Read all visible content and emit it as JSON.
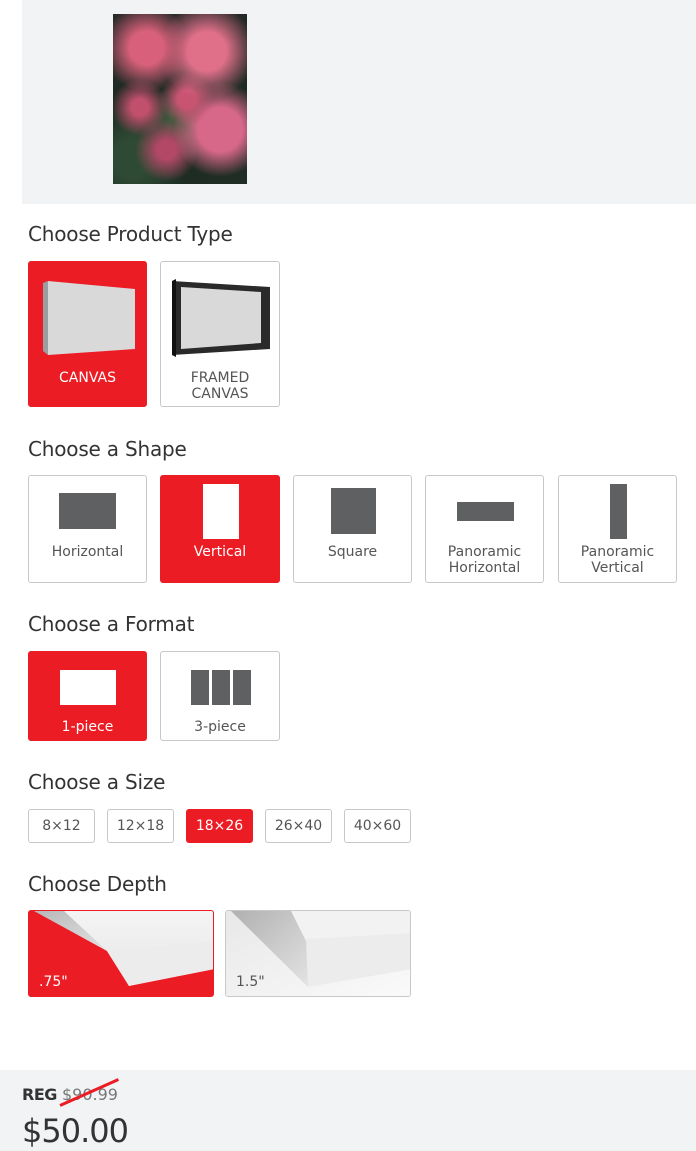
{
  "preview": {
    "image_alt": "pink flower buds artwork preview"
  },
  "product_type": {
    "title": "Choose Product Type",
    "options": [
      {
        "label": "CANVAS",
        "icon": "canvas-icon",
        "selected": true
      },
      {
        "label_lines": [
          "FRAMED",
          "CANVAS"
        ],
        "icon": "framed-canvas-icon",
        "selected": false
      }
    ]
  },
  "shape": {
    "title": "Choose a Shape",
    "options": [
      {
        "label_lines": [
          "Horizontal"
        ],
        "icon": "horizontal-shape-icon",
        "selected": false
      },
      {
        "label_lines": [
          "Vertical"
        ],
        "icon": "vertical-shape-icon",
        "selected": true
      },
      {
        "label_lines": [
          "Square"
        ],
        "icon": "square-shape-icon",
        "selected": false
      },
      {
        "label_lines": [
          "Panoramic",
          "Horizontal"
        ],
        "icon": "panoramic-horizontal-icon",
        "selected": false
      },
      {
        "label_lines": [
          "Panoramic",
          "Vertical"
        ],
        "icon": "panoramic-vertical-icon",
        "selected": false
      }
    ]
  },
  "format": {
    "title": "Choose a Format",
    "options": [
      {
        "label": "1-piece",
        "icon": "one-piece-icon",
        "selected": true
      },
      {
        "label": "3-piece",
        "icon": "three-piece-icon",
        "selected": false
      }
    ]
  },
  "size": {
    "title": "Choose a Size",
    "options": [
      {
        "label": "8×12",
        "selected": false
      },
      {
        "label": "12×18",
        "selected": false
      },
      {
        "label": "18×26",
        "selected": true
      },
      {
        "label": "26×40",
        "selected": false
      },
      {
        "label": "40×60",
        "selected": false
      }
    ]
  },
  "depth": {
    "title": "Choose Depth",
    "options": [
      {
        "label": ".75\"",
        "icon": "depth-075-icon",
        "selected": true
      },
      {
        "label": "1.5\"",
        "icon": "depth-15-icon",
        "selected": false
      }
    ]
  },
  "pricing": {
    "reg_label": "REG",
    "regular_price": "$90.99",
    "sale_price": "$50.00"
  },
  "colors": {
    "accent": "#ec1c24",
    "icon_gray": "#5f6062",
    "panel_bg": "#f2f3f5"
  }
}
